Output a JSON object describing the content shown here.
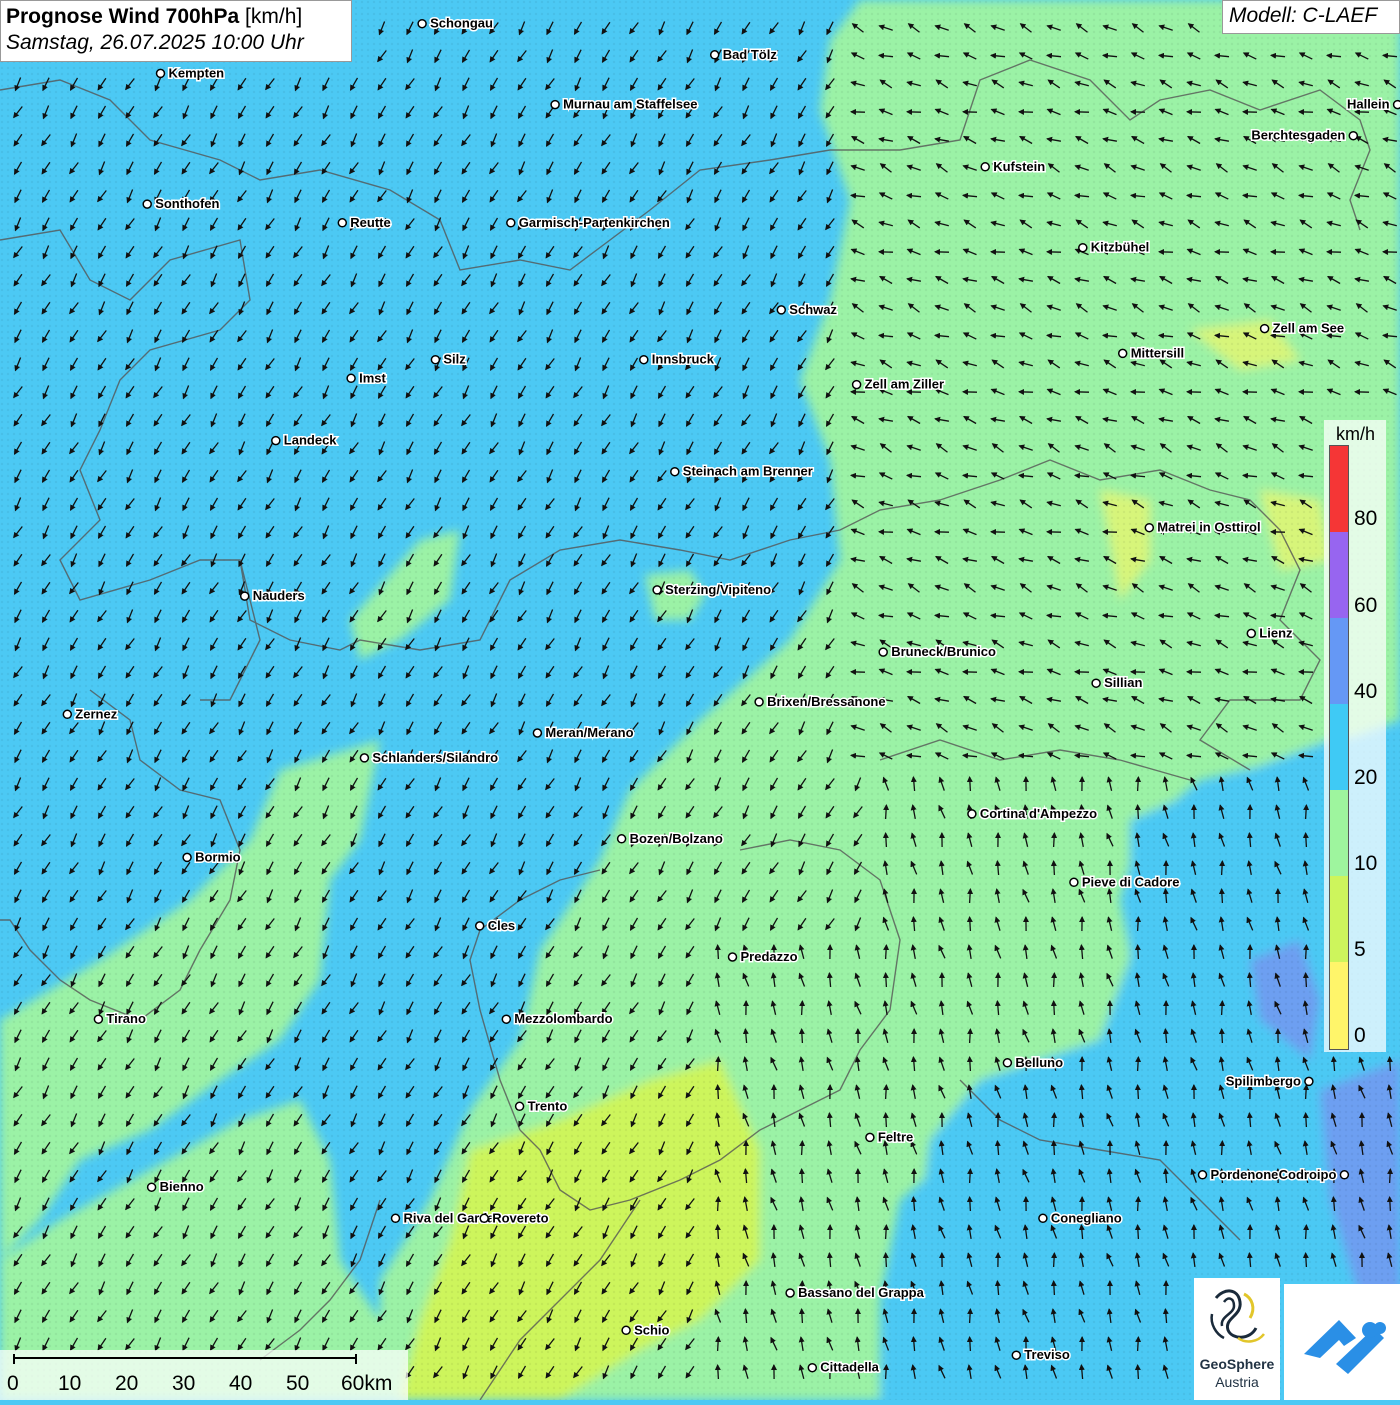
{
  "header": {
    "title_bold": "Prognose Wind 700hPa",
    "title_unit": "[km/h]",
    "datetime": "Samstag, 26.07.2025 10:00 Uhr"
  },
  "model_label": "Modell: C-LAEF",
  "legend": {
    "unit": "km/h",
    "bins": [
      {
        "label": "0",
        "color": "#fff56a"
      },
      {
        "label": "5",
        "color": "#cdf55c"
      },
      {
        "label": "10",
        "color": "#9ef59e"
      },
      {
        "label": "20",
        "color": "#3fcaf5"
      },
      {
        "label": "40",
        "color": "#6598f5"
      },
      {
        "label": "60",
        "color": "#9765f0"
      },
      {
        "label": "80",
        "color": "#f53636"
      }
    ]
  },
  "scale_bar": {
    "labels": [
      "0",
      "10",
      "20",
      "30",
      "40",
      "50",
      "60km"
    ]
  },
  "logos": {
    "geosphere_line1": "GeoSphere",
    "geosphere_line2": "Austria"
  },
  "cities": [
    {
      "name": "Schongau",
      "lon": 10.9,
      "lat": 47.81
    },
    {
      "name": "Bad Tölz",
      "lon": 11.56,
      "lat": 47.76
    },
    {
      "name": "Kempten",
      "lon": 10.31,
      "lat": 47.73
    },
    {
      "name": "Murnau am Staffelsee",
      "lon": 11.2,
      "lat": 47.68
    },
    {
      "name": "Hallein",
      "lon": 13.1,
      "lat": 47.68
    },
    {
      "name": "Berchtesgaden",
      "lon": 13.0,
      "lat": 47.63
    },
    {
      "name": "Kufstein",
      "lon": 12.17,
      "lat": 47.58
    },
    {
      "name": "Sonthofen",
      "lon": 10.28,
      "lat": 47.52
    },
    {
      "name": "Reutte",
      "lon": 10.72,
      "lat": 47.49
    },
    {
      "name": "Garmisch-Partenkirchen",
      "lon": 11.1,
      "lat": 47.49
    },
    {
      "name": "Kitzbühel",
      "lon": 12.39,
      "lat": 47.45
    },
    {
      "name": "Schwaz",
      "lon": 11.71,
      "lat": 47.35
    },
    {
      "name": "Zell am See",
      "lon": 12.8,
      "lat": 47.32
    },
    {
      "name": "Mittersill",
      "lon": 12.48,
      "lat": 47.28
    },
    {
      "name": "Innsbruck",
      "lon": 11.4,
      "lat": 47.27
    },
    {
      "name": "Silz",
      "lon": 10.93,
      "lat": 47.27
    },
    {
      "name": "Imst",
      "lon": 10.74,
      "lat": 47.24
    },
    {
      "name": "Zell am Ziller",
      "lon": 11.88,
      "lat": 47.23
    },
    {
      "name": "Landeck",
      "lon": 10.57,
      "lat": 47.14
    },
    {
      "name": "Steinach am Brenner",
      "lon": 11.47,
      "lat": 47.09
    },
    {
      "name": "Matrei in Osttirol",
      "lon": 12.54,
      "lat": 47.0
    },
    {
      "name": "Sterzing/Vipiteno",
      "lon": 11.43,
      "lat": 46.9
    },
    {
      "name": "Nauders",
      "lon": 10.5,
      "lat": 46.89
    },
    {
      "name": "Lienz",
      "lon": 12.77,
      "lat": 46.83
    },
    {
      "name": "Bruneck/Brunico",
      "lon": 11.94,
      "lat": 46.8
    },
    {
      "name": "Sillian",
      "lon": 12.42,
      "lat": 46.75
    },
    {
      "name": "Brixen/Bressanone",
      "lon": 11.66,
      "lat": 46.72
    },
    {
      "name": "Zernez",
      "lon": 10.1,
      "lat": 46.7
    },
    {
      "name": "Meran/Merano",
      "lon": 11.16,
      "lat": 46.67
    },
    {
      "name": "Schlanders/Silandro",
      "lon": 10.77,
      "lat": 46.63
    },
    {
      "name": "Cortina d'Ampezzo",
      "lon": 12.14,
      "lat": 46.54
    },
    {
      "name": "Bozen/Bolzano",
      "lon": 11.35,
      "lat": 46.5
    },
    {
      "name": "Bormio",
      "lon": 10.37,
      "lat": 46.47
    },
    {
      "name": "Pieve di Cadore",
      "lon": 12.37,
      "lat": 46.43
    },
    {
      "name": "Cles",
      "lon": 11.03,
      "lat": 46.36
    },
    {
      "name": "Predazzo",
      "lon": 11.6,
      "lat": 46.31
    },
    {
      "name": "Mezzolombardo",
      "lon": 11.09,
      "lat": 46.21
    },
    {
      "name": "Tirano",
      "lon": 10.17,
      "lat": 46.21
    },
    {
      "name": "Belluno",
      "lon": 12.22,
      "lat": 46.14
    },
    {
      "name": "Spilimbergo",
      "lon": 12.9,
      "lat": 46.11
    },
    {
      "name": "Trento",
      "lon": 11.12,
      "lat": 46.07
    },
    {
      "name": "Feltre",
      "lon": 11.91,
      "lat": 46.02
    },
    {
      "name": "Pordenone",
      "lon": 12.66,
      "lat": 45.96
    },
    {
      "name": "Codroipo",
      "lon": 12.98,
      "lat": 45.96
    },
    {
      "name": "Bienno",
      "lon": 10.29,
      "lat": 45.94
    },
    {
      "name": "Riva del Garda",
      "lon": 10.84,
      "lat": 45.89
    },
    {
      "name": "Rovereto",
      "lon": 11.04,
      "lat": 45.89
    },
    {
      "name": "Conegliano",
      "lon": 12.3,
      "lat": 45.89
    },
    {
      "name": "Bassano del Grappa",
      "lon": 11.73,
      "lat": 45.77
    },
    {
      "name": "Schio",
      "lon": 11.36,
      "lat": 45.71
    },
    {
      "name": "Treviso",
      "lon": 12.24,
      "lat": 45.67
    },
    {
      "name": "Cittadella",
      "lon": 11.78,
      "lat": 45.65
    }
  ]
}
